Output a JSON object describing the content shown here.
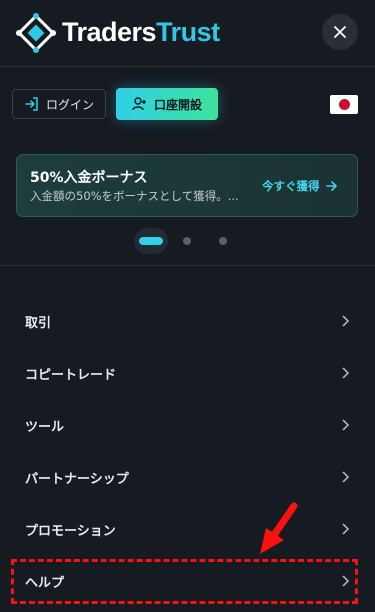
{
  "brand": {
    "name_part1": "Traders",
    "name_part2": "Trust",
    "accent": "#2fc8e6"
  },
  "header": {
    "close_icon": "close-icon"
  },
  "auth": {
    "login_label": "ログイン",
    "open_account_label": "口座開設"
  },
  "locale": {
    "flag": "japan-flag"
  },
  "promo": {
    "title": "50%入金ボーナス",
    "subtitle": "入金額の50%をボーナスとして獲得。...",
    "cta": "今すぐ獲得"
  },
  "carousel": {
    "total": 3,
    "active": 1
  },
  "menu": {
    "items": [
      {
        "label": "取引"
      },
      {
        "label": "コピートレード"
      },
      {
        "label": "ツール"
      },
      {
        "label": "パートナーシップ"
      },
      {
        "label": "プロモーション"
      },
      {
        "label": "ヘルプ",
        "highlighted": true
      }
    ]
  },
  "colors": {
    "background": "#161a21",
    "cta_gradient_start": "#2fd0e8",
    "cta_gradient_end": "#3ee39a",
    "annotation": "#ff1010"
  }
}
